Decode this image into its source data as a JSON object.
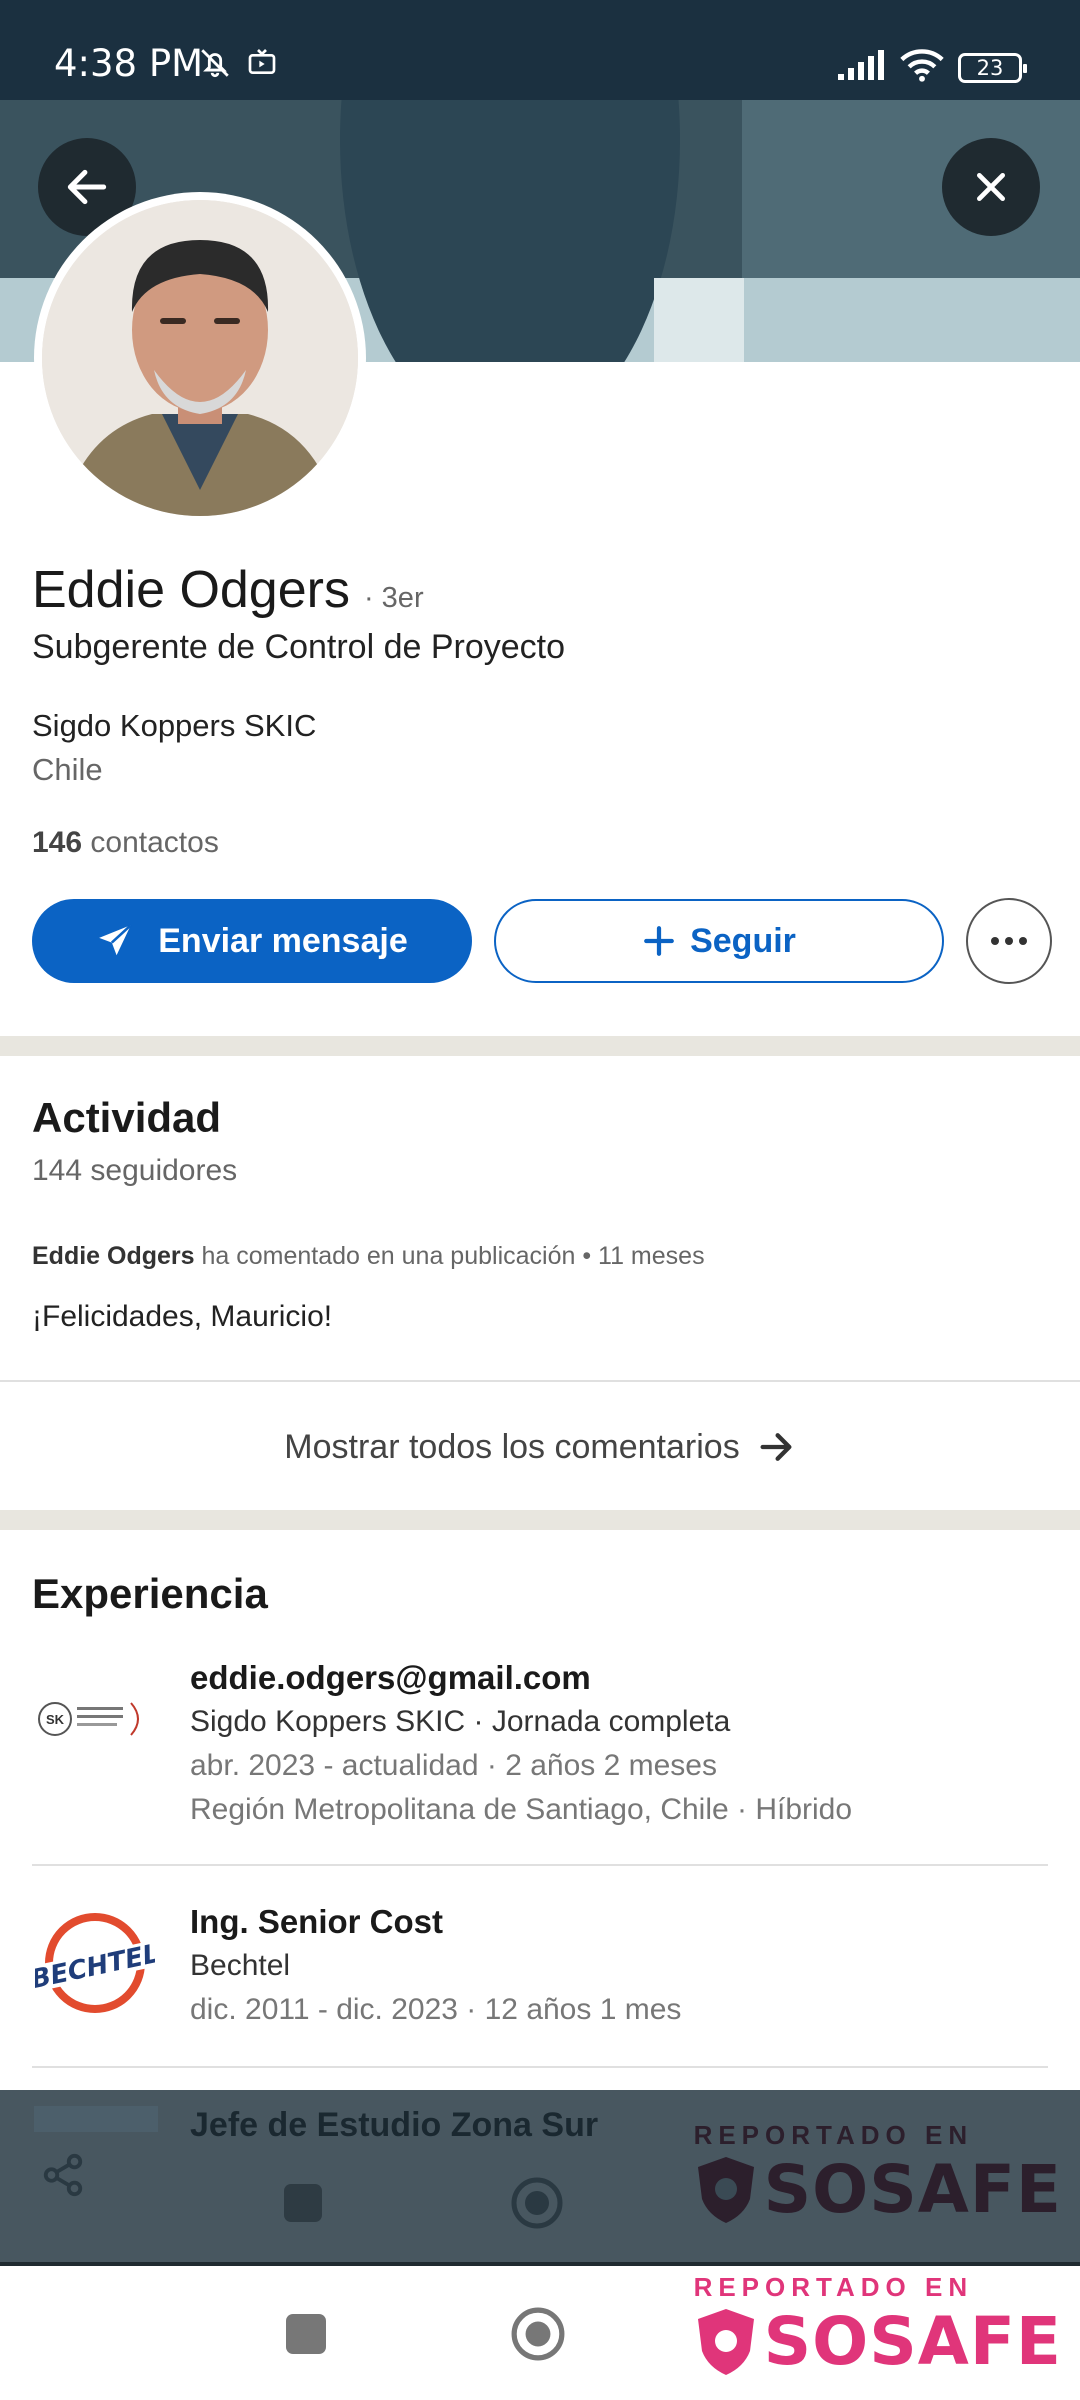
{
  "status_bar": {
    "time": "4:38 PM",
    "battery": "23",
    "icons": [
      "mute-icon",
      "tv-icon",
      "signal-icon",
      "wifi-icon",
      "battery-icon"
    ]
  },
  "header": {
    "back_icon": "arrow-left-icon",
    "close_icon": "close-icon"
  },
  "profile": {
    "name": "Eddie Odgers",
    "degree": "· 3er",
    "headline": "Subgerente de Control de Proyecto",
    "company": "Sigdo Koppers SKIC",
    "location": "Chile",
    "contacts_count": "146",
    "contacts_label": "contactos"
  },
  "actions": {
    "message_label": "Enviar mensaje",
    "follow_label": "Seguir"
  },
  "activity": {
    "title": "Actividad",
    "followers": "144 seguidores",
    "author": "Eddie Odgers",
    "meta": "ha comentado en una publicación • 11 meses",
    "comment": "¡Felicidades, Mauricio!",
    "show_all": "Mostrar todos los comentarios"
  },
  "experience": {
    "title": "Experiencia",
    "items": [
      {
        "title": "eddie.odgers@gmail.com",
        "company": "Sigdo Koppers SKIC · Jornada completa",
        "dates": "abr. 2023 - actualidad · 2 años 2 meses",
        "location": "Región Metropolitana de Santiago, Chile · Híbrido",
        "logo_text": "SK SIGDO KOPPERS"
      },
      {
        "title": "Ing. Senior Cost",
        "company": "Bechtel",
        "dates": "dic. 2011 - dic. 2023 · 12 años 1 mes",
        "logo_text": "BECHTEL"
      },
      {
        "title": "Jefe de Estudio Zona Sur"
      }
    ]
  },
  "watermark": {
    "top": "REPORTADO EN",
    "brand": "SOSAFE",
    "color": "#e0357a"
  },
  "colors": {
    "primary": "#0b63c4",
    "status_bar": "#1b3040"
  }
}
